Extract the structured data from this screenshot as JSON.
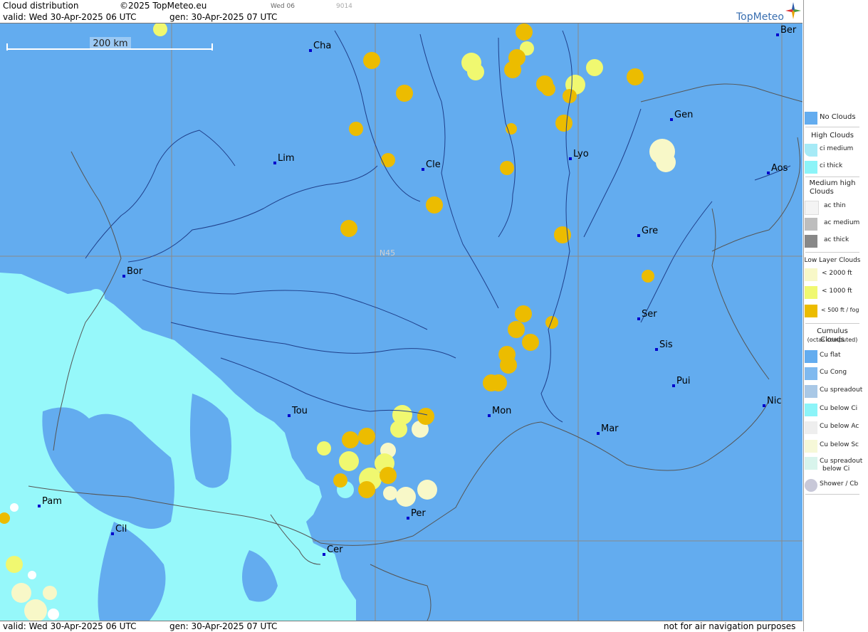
{
  "header": {
    "title": "Cloud distribution",
    "copyright": "©2025 TopMeteo.eu",
    "valid": "valid:  Wed  30-Apr-2025  06 UTC",
    "gen": "gen: 30-Apr-2025 07 UTC",
    "small_day": "Wed 06",
    "small_code": "9014",
    "brand": "TopMeteo"
  },
  "footer": {
    "valid": "valid:  Wed  30-Apr-2025  06 UTC",
    "gen": "gen: 30-Apr-2025 07 UTC",
    "disclaimer": "not for air navigation purposes"
  },
  "map": {
    "scale_label": "200 km",
    "lat_label": "N45",
    "colors": {
      "no_clouds": "#63acef",
      "cirrus": "#96f8fa",
      "low_2000": "#f8f8c8",
      "low_1000": "#f0f870",
      "low_500": "#ecbc00",
      "city": "#0000cc",
      "river": "#1f3f8a",
      "border": "#555555"
    },
    "cities": [
      {
        "name": "Cha"
      },
      {
        "name": "Ber"
      },
      {
        "name": "Gen"
      },
      {
        "name": "Lim"
      },
      {
        "name": "Cle"
      },
      {
        "name": "Lyo"
      },
      {
        "name": "Aos"
      },
      {
        "name": "Gre"
      },
      {
        "name": "Bor"
      },
      {
        "name": "Ser"
      },
      {
        "name": "Sis"
      },
      {
        "name": "Pui"
      },
      {
        "name": "Tou"
      },
      {
        "name": "Mon"
      },
      {
        "name": "Mar"
      },
      {
        "name": "Nic"
      },
      {
        "name": "Pam"
      },
      {
        "name": "Per"
      },
      {
        "name": "Cil"
      },
      {
        "name": "Cer"
      }
    ]
  },
  "legend": {
    "no_clouds": "No Clouds",
    "high_head": "High Clouds",
    "ci_medium": "ci medium",
    "ci_thick": "ci thick",
    "medium_head_1": "Medium high",
    "medium_head_2": "Clouds",
    "ac_thin": "ac thin",
    "ac_medium": "ac medium",
    "ac_thick": "ac thick",
    "low_head": "Low Layer Clouds",
    "low_2000": "< 2000 ft",
    "low_1000": "< 1000 ft",
    "low_500": "< 500 ft / fog",
    "cu_head": "Cumulus Clouds",
    "cu_sub": "(octas computed)",
    "cu_flat": "Cu flat",
    "cu_cong": "Cu Cong",
    "cu_spreadout": "Cu spreadout",
    "cu_below_ci": "Cu below Ci",
    "cu_below_ac": "Cu below Ac",
    "cu_below_sc": "Cu below Sc",
    "cu_spread_ci_1": "Cu spreadout",
    "cu_spread_ci_2": "below Ci",
    "shower": "Shower / Cb"
  }
}
